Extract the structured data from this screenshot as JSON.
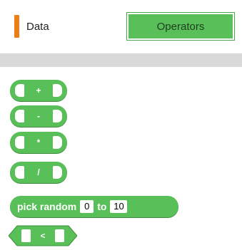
{
  "categories": {
    "data": {
      "label": "Data",
      "color": "#ee7d16"
    },
    "operators": {
      "label": "Operators",
      "color": "#59c059",
      "selected": true
    }
  },
  "blocks": [
    {
      "kind": "reporter",
      "op": "+"
    },
    {
      "kind": "reporter",
      "op": "-"
    },
    {
      "kind": "reporter",
      "op": "*"
    },
    {
      "kind": "reporter",
      "op": "/"
    },
    {
      "kind": "reporter",
      "label": "pick random",
      "from": "0",
      "joiner": "to",
      "to": "10"
    },
    {
      "kind": "boolean",
      "op": "<"
    }
  ],
  "palette": {
    "block_color": "#59c059"
  }
}
